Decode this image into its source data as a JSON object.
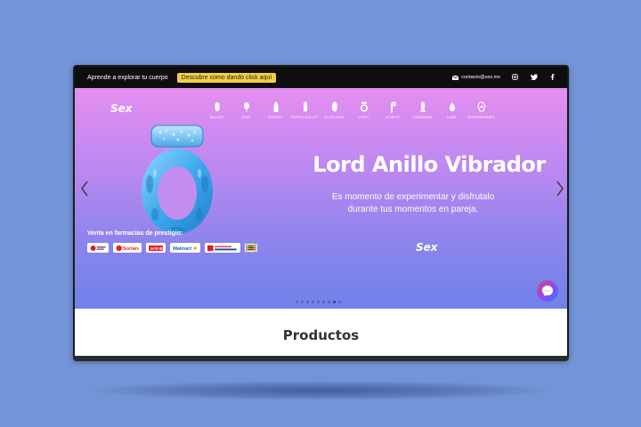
{
  "topbar": {
    "tagline": "Aprende a explorar tu cuerpo",
    "cta": "Descubre como dando click aquí",
    "email": "contacto@sex.mx",
    "social": [
      "instagram-icon",
      "twitter-icon",
      "facebook-icon"
    ]
  },
  "brand": {
    "logo": "Sex"
  },
  "nav": [
    {
      "label": "BULLET",
      "icon": "bullet-icon"
    },
    {
      "label": "EGG",
      "icon": "egg-icon"
    },
    {
      "label": "ROCKET",
      "icon": "rocket-icon"
    },
    {
      "label": "SUPER BULLET",
      "icon": "super-bullet-icon"
    },
    {
      "label": "ELITE KING",
      "icon": "elite-king-icon"
    },
    {
      "label": "LORD",
      "icon": "lord-icon"
    },
    {
      "label": "G SPOT",
      "icon": "g-spot-icon"
    },
    {
      "label": "CONDOMS",
      "icon": "condoms-icon"
    },
    {
      "label": "LUBE",
      "icon": "lube-icon"
    },
    {
      "label": "PHEROMONES",
      "icon": "pheromones-icon"
    }
  ],
  "hero": {
    "headline": "Lord Anillo Vibrador",
    "subtext": "Es momento de experimentar y disfrutalo durante tus momentos en pareja.",
    "brand": "Sex",
    "pharmacies_title": "Venta en farmacias de prestigio:",
    "pharmacies": [
      "Farmacias del Ahorro",
      "Soriana",
      "HEB",
      "Walmart",
      "Benavides",
      "7-Eleven"
    ],
    "carousel_count": 9,
    "carousel_active": 8
  },
  "products": {
    "title": "Productos"
  },
  "colors": {
    "topbar": "#0e0e0e",
    "cta": "#f4d03f",
    "background": "#7394d6"
  }
}
